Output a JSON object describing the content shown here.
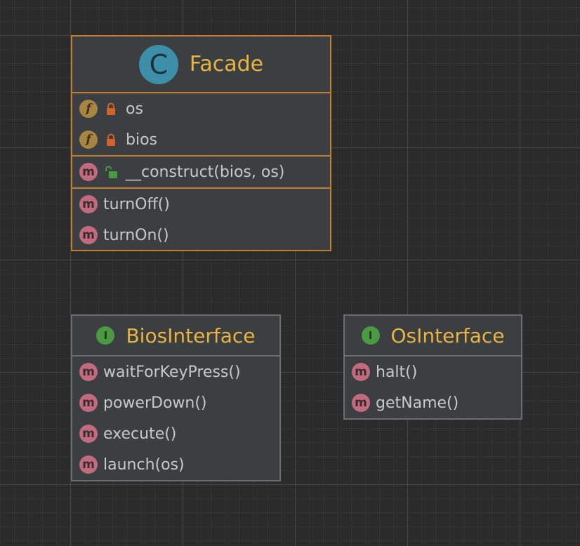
{
  "colors": {
    "canvas_background": "#2b2b2b",
    "node_background": "#3c3f41",
    "node_border": "#6b6e70",
    "selected_border": "#c57d2f",
    "title_color": "#e8b340",
    "member_text": "#c8c8c8",
    "method_badge": "#c06b7e",
    "field_badge": "#a88540",
    "class_badge": "#3d8ea8",
    "interface_badge": "#4b9a42",
    "private_lock": "#d0622b",
    "public_lock": "#4b9a42"
  },
  "facade": {
    "kind": "class",
    "kind_letter": "C",
    "title": "Facade",
    "selected": true,
    "fields": [
      {
        "badge_letter": "f",
        "visibility": "private",
        "text": "os"
      },
      {
        "badge_letter": "f",
        "visibility": "private",
        "text": "bios"
      }
    ],
    "constructors": [
      {
        "badge_letter": "m",
        "visibility": "public",
        "text": "__construct(bios, os)"
      }
    ],
    "methods": [
      {
        "badge_letter": "m",
        "text": "turnOff()"
      },
      {
        "badge_letter": "m",
        "text": "turnOn()"
      }
    ]
  },
  "bios_interface": {
    "kind": "interface",
    "kind_letter": "I",
    "title": "BiosInterface",
    "methods": [
      {
        "badge_letter": "m",
        "text": "waitForKeyPress()"
      },
      {
        "badge_letter": "m",
        "text": "powerDown()"
      },
      {
        "badge_letter": "m",
        "text": "execute()"
      },
      {
        "badge_letter": "m",
        "text": "launch(os)"
      }
    ]
  },
  "os_interface": {
    "kind": "interface",
    "kind_letter": "I",
    "title": "OsInterface",
    "methods": [
      {
        "badge_letter": "m",
        "text": "halt()"
      },
      {
        "badge_letter": "m",
        "text": "getName()"
      }
    ]
  }
}
